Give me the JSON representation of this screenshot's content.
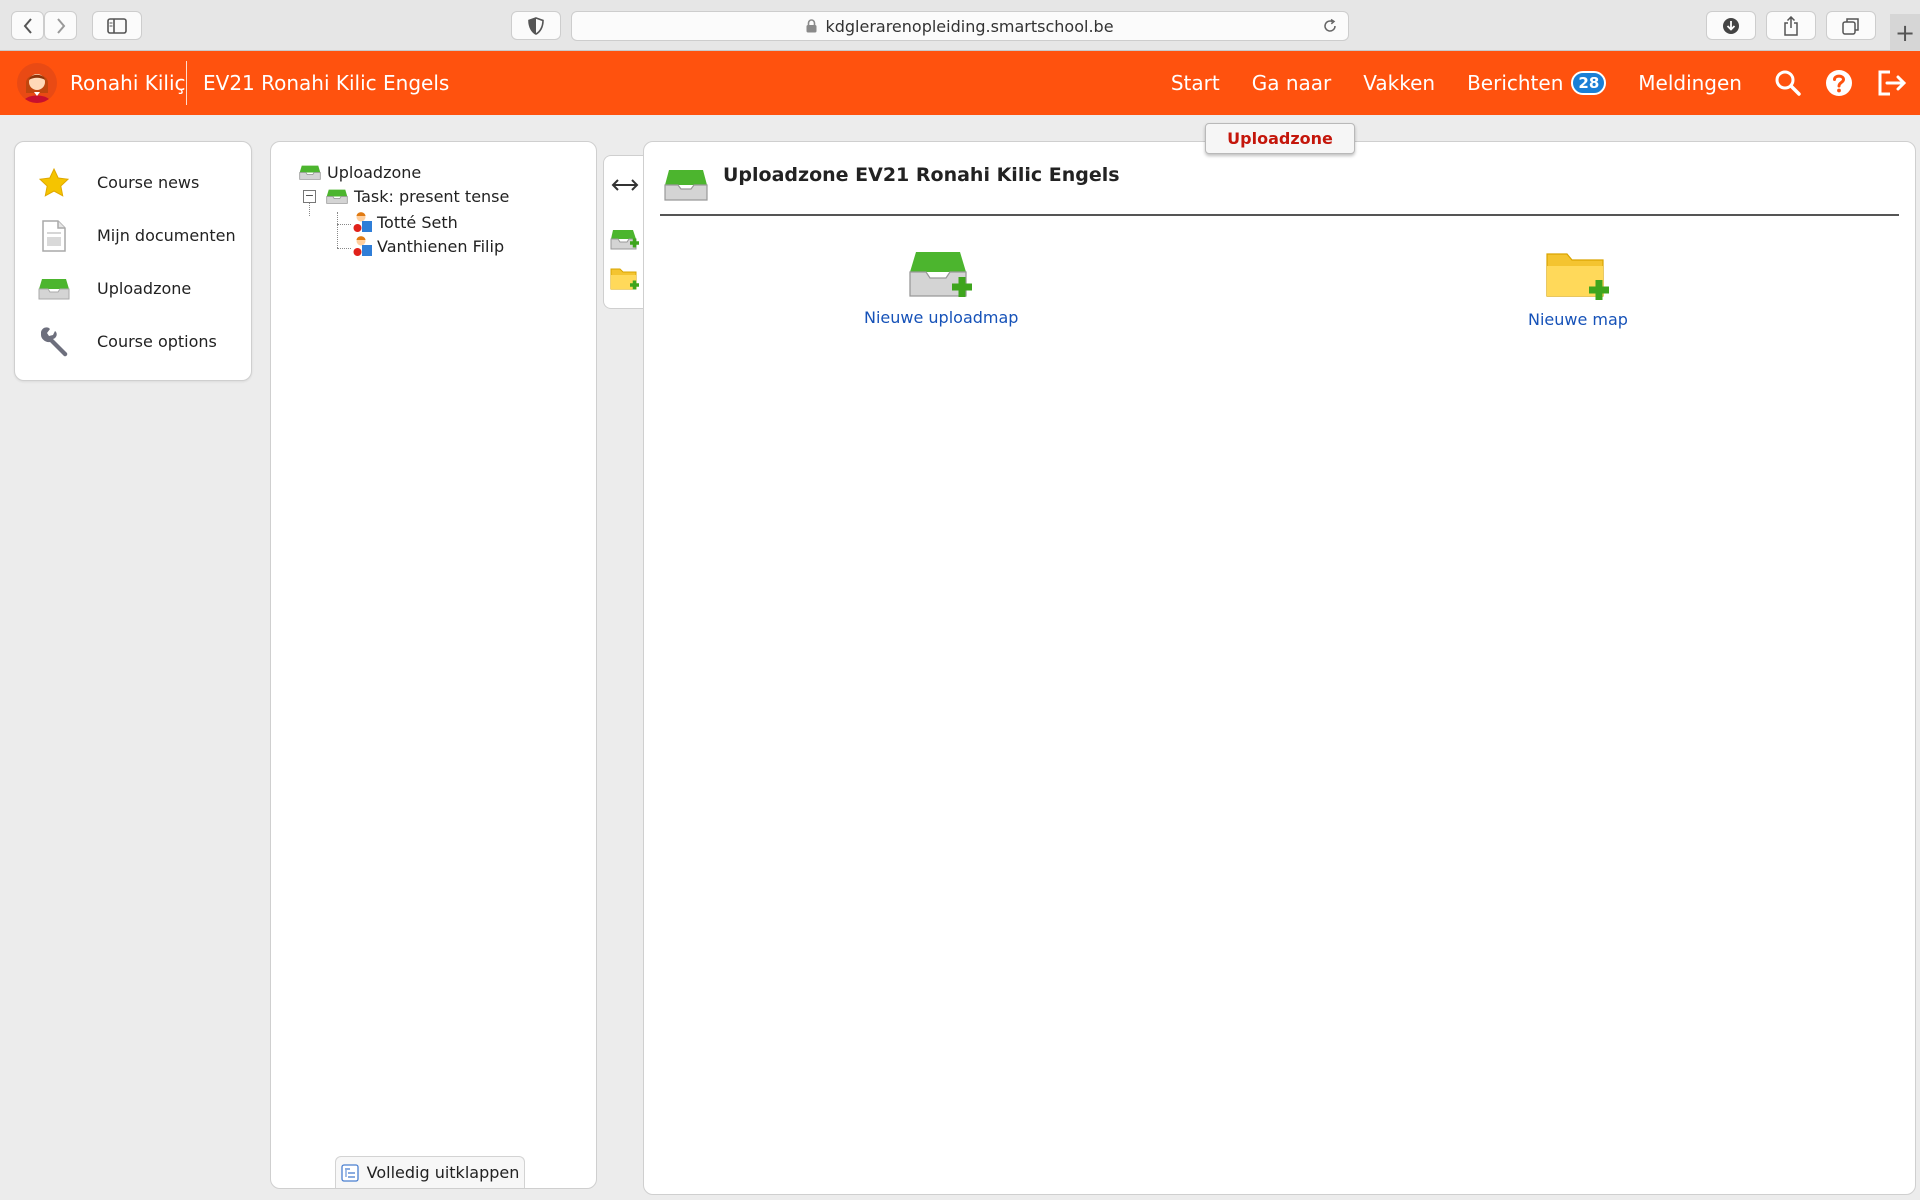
{
  "browser": {
    "url": "kdglerarenopleiding.smartschool.be",
    "new_tab": "+"
  },
  "topbar": {
    "user_name": "Ronahi Kiliç",
    "course_name": "EV21 Ronahi Kilic Engels",
    "nav": {
      "start": "Start",
      "go_to": "Ga naar",
      "courses": "Vakken",
      "messages": "Berichten",
      "messages_count": "28",
      "notifications": "Meldingen"
    },
    "colors": {
      "bar": "#ff520e",
      "badge": "#1a7fd6"
    }
  },
  "left_menu": {
    "items": [
      {
        "label": "Course news",
        "icon": "star-icon"
      },
      {
        "label": "Mijn documenten",
        "icon": "document-icon"
      },
      {
        "label": "Uploadzone",
        "icon": "inbox-icon"
      },
      {
        "label": "Course options",
        "icon": "wrench-icon"
      }
    ]
  },
  "tree": {
    "root": "Uploadzone",
    "task": "Task: present tense",
    "expander": "−",
    "children": [
      "Totté Seth",
      "Vanthienen Filip"
    ],
    "expand_all": "Volledig uitklappen"
  },
  "main": {
    "tab_label": "Uploadzone",
    "title": "Uploadzone EV21 Ronahi Kilic Engels",
    "actions": [
      {
        "label": "Nieuwe uploadmap",
        "icon": "new-upload-folder-icon"
      },
      {
        "label": "Nieuwe map",
        "icon": "new-folder-icon"
      }
    ],
    "colors": {
      "tab_text": "#c4160b",
      "link": "#1652b8"
    }
  }
}
